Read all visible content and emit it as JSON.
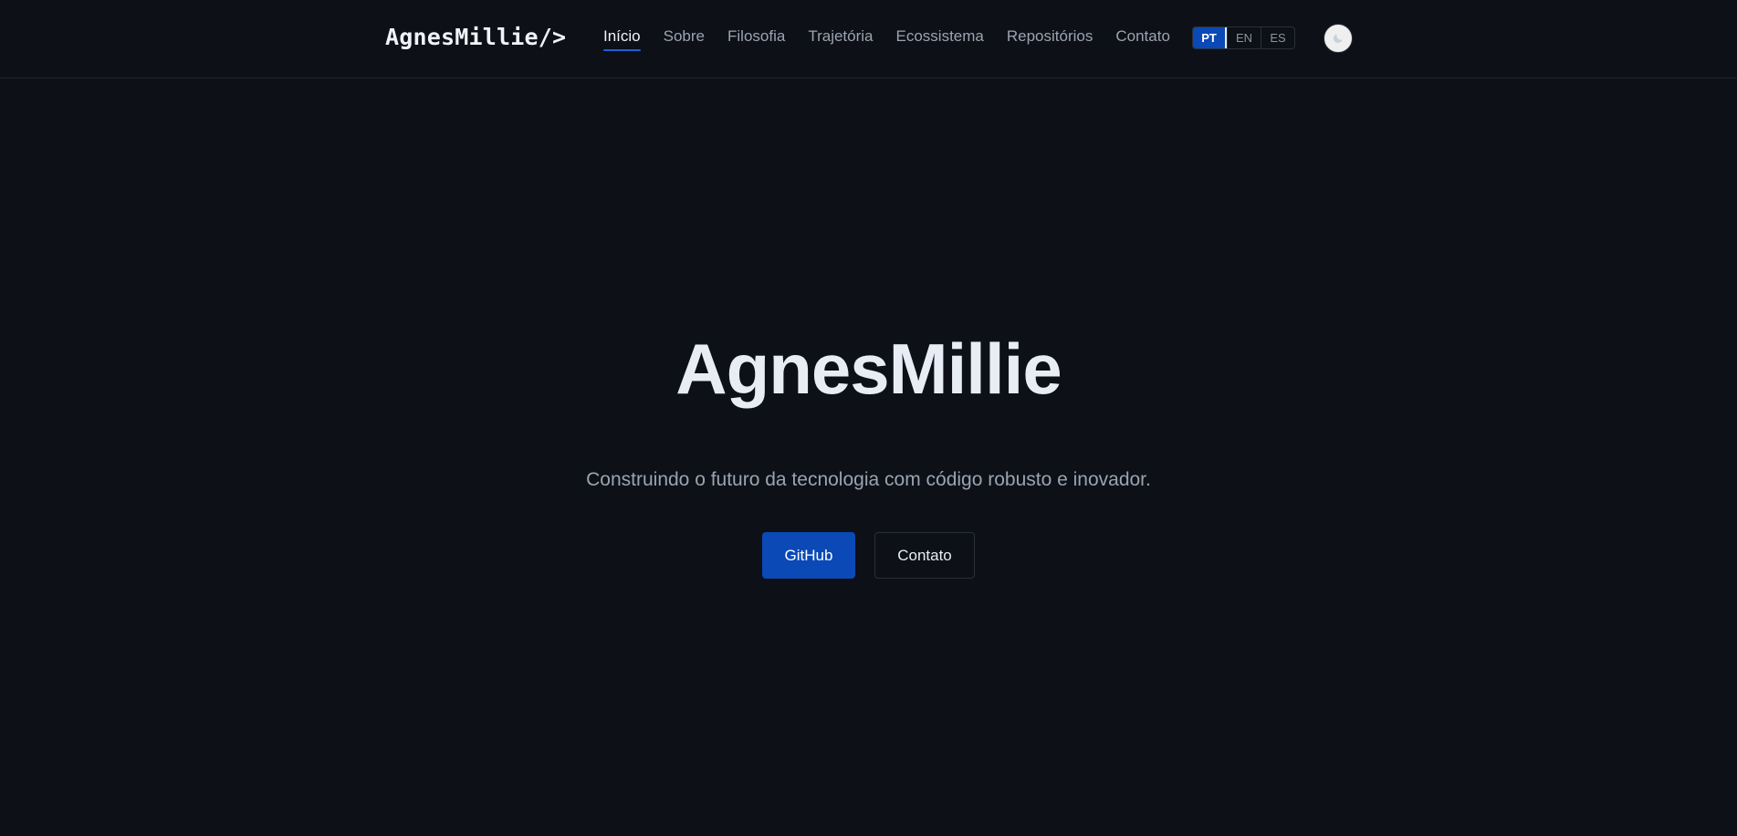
{
  "header": {
    "logo_text": "AgnesMillie",
    "logo_suffix": "/>",
    "nav_items": [
      {
        "label": "Início",
        "active": true
      },
      {
        "label": "Sobre",
        "active": false
      },
      {
        "label": "Filosofia",
        "active": false
      },
      {
        "label": "Trajetória",
        "active": false
      },
      {
        "label": "Ecossistema",
        "active": false
      },
      {
        "label": "Repositórios",
        "active": false
      },
      {
        "label": "Contato",
        "active": false
      }
    ],
    "languages": [
      {
        "label": "PT",
        "active": true
      },
      {
        "label": "EN",
        "active": false
      },
      {
        "label": "ES",
        "active": false
      }
    ],
    "theme_icon": "moon-icon"
  },
  "hero": {
    "title": "AgnesMillie",
    "subtitle": "Construindo o futuro da tecnologia com código robusto e inovador.",
    "primary_button": "GitHub",
    "secondary_button": "Contato"
  },
  "colors": {
    "background": "#0d1017",
    "accent": "#0b49b7",
    "text_primary": "#e8edf5",
    "text_muted": "#9aa4b1",
    "border": "#2a3039"
  }
}
